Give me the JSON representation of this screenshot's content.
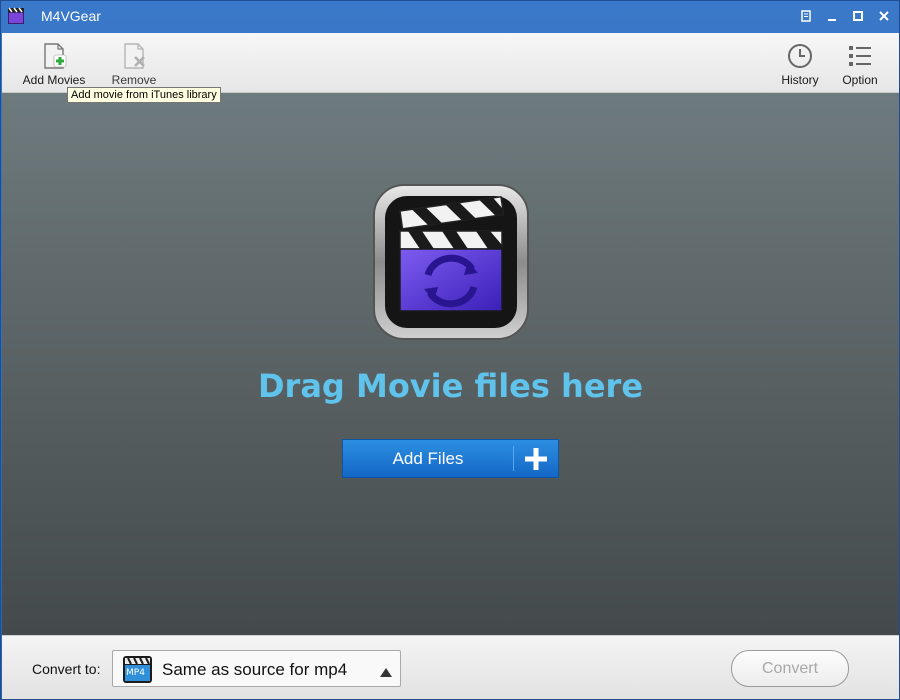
{
  "window": {
    "title": "M4VGear"
  },
  "toolbar": {
    "add_movies_label": "Add Movies",
    "remove_label": "Remove",
    "history_label": "History",
    "option_label": "Option",
    "tooltip": "Add movie from iTunes library"
  },
  "main": {
    "drag_text": "Drag Movie files here",
    "add_files_label": "Add Files"
  },
  "bottom": {
    "convert_to_label": "Convert to:",
    "format_value": "Same as source for mp4",
    "format_icon_text": "MP4",
    "convert_label": "Convert"
  },
  "icons": [
    "app-icon",
    "restore-icon",
    "minimize-icon",
    "maximize-icon",
    "close-icon",
    "add-movie-icon",
    "remove-icon",
    "history-clock-icon",
    "option-list-icon",
    "clapperboard-logo-icon",
    "plus-icon",
    "chevron-up-icon"
  ],
  "colors": {
    "accent": "#5fc3ec",
    "button_blue": "#1f7fd8",
    "titlebar": "#2f6abb"
  }
}
